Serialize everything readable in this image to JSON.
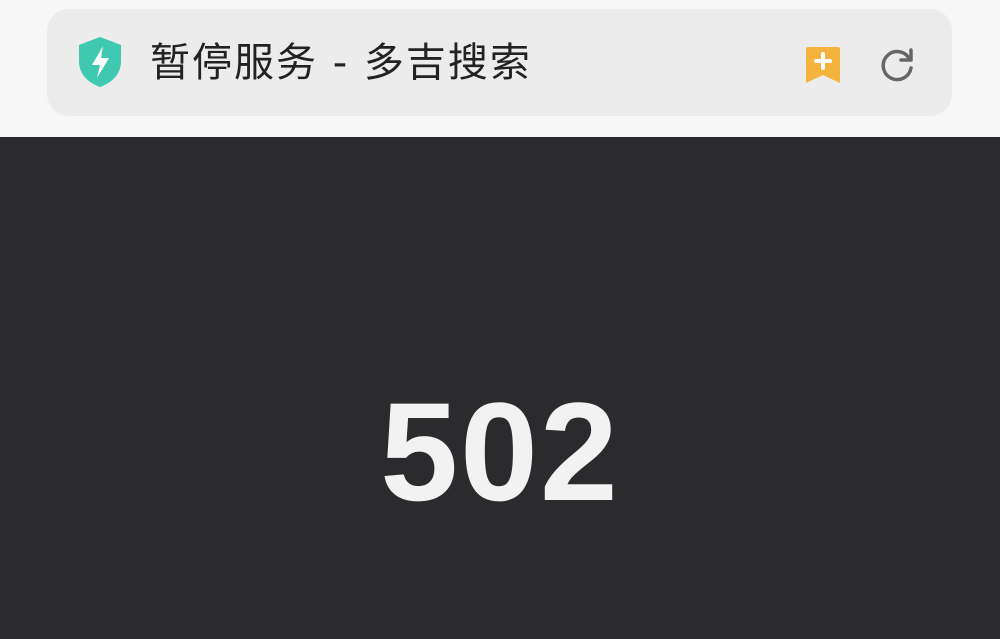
{
  "browser": {
    "title": "暂停服务 - 多吉搜索",
    "icons": {
      "security": "shield-lightning-icon",
      "bookmark": "bookmark-add-icon",
      "reload": "reload-icon"
    }
  },
  "error": {
    "code": "502"
  },
  "colors": {
    "shield": "#3ec9b0",
    "bookmark": "#f5b23c",
    "content_background": "#2b2b2d",
    "error_text": "#f2f2f2"
  }
}
